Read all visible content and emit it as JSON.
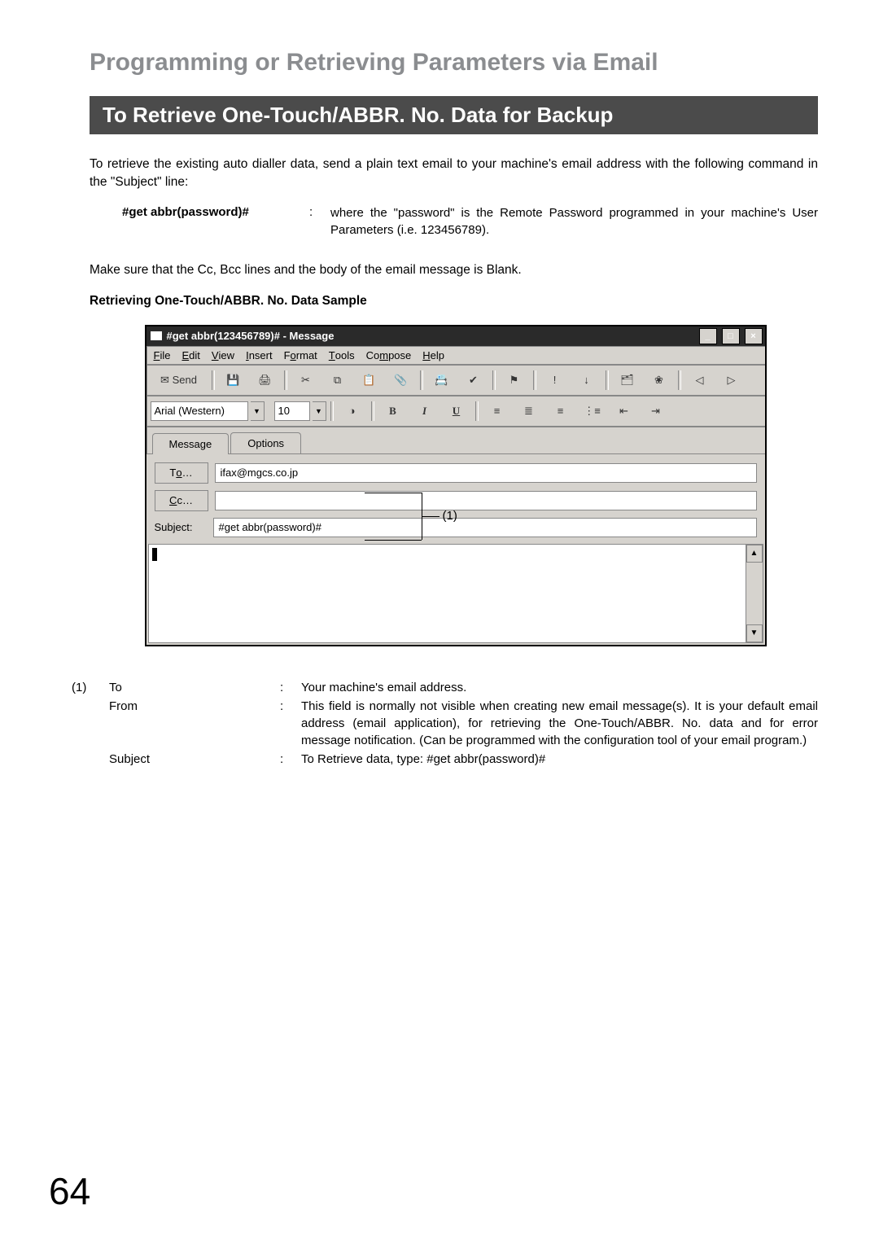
{
  "heading": "Programming or Retrieving Parameters via Email",
  "darkbar": "To Retrieve One-Touch/ABBR. No. Data for Backup",
  "intro": "To retrieve the existing auto dialler data, send a plain text email to your machine's email address with the following command in the \"Subject\" line:",
  "command": {
    "label": "#get abbr(password)#",
    "sep": ":",
    "desc": "where the \"password\" is the Remote Password programmed in your machine's User Parameters (i.e. 123456789)."
  },
  "blank_note": "Make sure that the Cc, Bcc lines and the body of the email message is Blank.",
  "sample_heading": "Retrieving One-Touch/ABBR. No. Data Sample",
  "mail": {
    "title": "#get abbr(123456789)# - Message",
    "menu": {
      "file": "File",
      "edit": "Edit",
      "view": "View",
      "insert": "Insert",
      "format": "Format",
      "tools": "Tools",
      "compose": "Compose",
      "help": "Help"
    },
    "toolbar": {
      "send": "Send",
      "font_name": "Arial (Western)",
      "font_size": "10"
    },
    "tabs": {
      "message": "Message",
      "options": "Options"
    },
    "fields": {
      "to_label": "To…",
      "to_value": "ifax@mgcs.co.jp",
      "cc_label": "Cc…",
      "cc_value": "",
      "subject_label": "Subject:",
      "subject_value": "#get abbr(password)#"
    }
  },
  "callout_label": "(1)",
  "legend": {
    "num": "(1)",
    "rows": [
      {
        "key": "To",
        "sep": ":",
        "val": "Your machine's email address."
      },
      {
        "key": "From",
        "sep": ":",
        "val": "This field is normally not visible when creating new email message(s). It is your default email address (email application), for retrieving the One-Touch/ABBR. No. data and for error message notification. (Can be programmed with the configuration tool of your email program.)"
      },
      {
        "key": "Subject",
        "sep": ":",
        "val": "To Retrieve data, type: #get abbr(password)#"
      }
    ]
  },
  "page_number": "64"
}
